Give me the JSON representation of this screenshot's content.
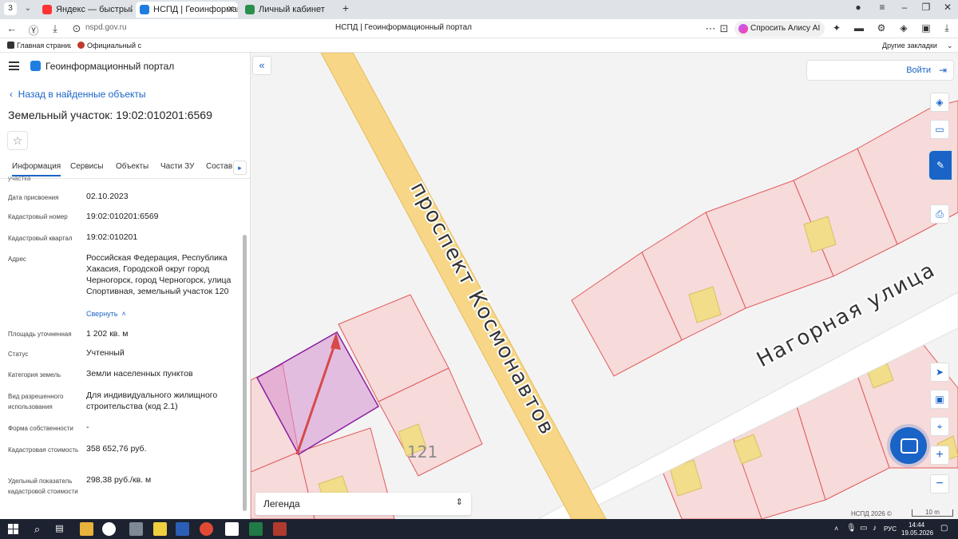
{
  "browser": {
    "tab_count": "3",
    "tabs": [
      {
        "title": "Яндекс — быстрый поиск",
        "color": "#f33"
      },
      {
        "title": "НСПД | Геоинформацио",
        "color": "#1f7de0"
      },
      {
        "title": "Личный кабинет",
        "color": "#2a8f4a"
      }
    ],
    "url": "nspd.gov.ru",
    "page_title": "НСПД | Геоинформационный портал",
    "alice_label": "Спросить Алису AI",
    "bookmarks": [
      "Главная страница",
      "Официальный са"
    ],
    "other_bookmarks": "Другие закладки"
  },
  "sidebar": {
    "app_title": "Геоинформационный портал",
    "back_label": "Назад в найденные объекты",
    "object_title": "Земельный участок: 19:02:010201:6569",
    "tabs": [
      "Информация",
      "Сервисы",
      "Объекты",
      "Части ЗУ",
      "Состав"
    ],
    "cut_text": "участка",
    "fields": [
      {
        "label": "Дата присвоения",
        "value": "02.10.2023"
      },
      {
        "label": "Кадастровый номер",
        "value": "19:02:010201:6569"
      },
      {
        "label": "Кадастровый квартал",
        "value": "19:02:010201"
      },
      {
        "label": "Адрес",
        "value": "Российская Федерация, Республика Хакасия, Городской округ город Черногорск, город Черногорск, улица Спортивная, земельный участок 120"
      },
      {
        "label": "Площадь уточненная",
        "value": "1 202 кв. м"
      },
      {
        "label": "Статус",
        "value": "Учтенный"
      },
      {
        "label": "Категория земель",
        "value": "Земли населенных пунктов"
      },
      {
        "label": "Вид разрешенного использования",
        "value": "Для индивидуального жилищного строительства (код 2.1)"
      },
      {
        "label": "Форма собственности",
        "value": "-"
      },
      {
        "label": "Кадастровая стоимость",
        "value": "358 652,76 руб."
      },
      {
        "label": "Удельный показатель кадастровой стоимости",
        "value": "298,38 руб./кв. м"
      }
    ],
    "collapse_label": "Свернуть"
  },
  "map": {
    "login_label": "Войти",
    "legend_label": "Легенда",
    "street_main": "проспект Космонавтов",
    "street_side": "Нагорная улица",
    "parcel_number": "121",
    "copyright": "НСПД 2026 ©",
    "scale_label": "10 m"
  },
  "taskbar": {
    "lang": "РУС",
    "time": "14:44",
    "date": "19.05.2026"
  }
}
